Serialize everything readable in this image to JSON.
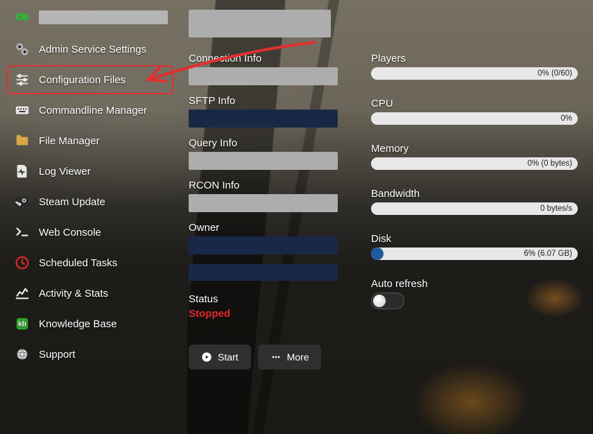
{
  "sidebar": {
    "items": [
      {
        "label": "Admin Service Settings",
        "icon": "gear-icon"
      },
      {
        "label": "Configuration Files",
        "icon": "sliders-icon",
        "highlighted": true
      },
      {
        "label": "Commandline Manager",
        "icon": "keyboard-icon"
      },
      {
        "label": "File Manager",
        "icon": "folder-icon"
      },
      {
        "label": "Log Viewer",
        "icon": "file-pulse-icon"
      },
      {
        "label": "Steam Update",
        "icon": "steam-icon"
      },
      {
        "label": "Web Console",
        "icon": "terminal-icon"
      },
      {
        "label": "Scheduled Tasks",
        "icon": "clock-icon"
      },
      {
        "label": "Activity & Stats",
        "icon": "chart-icon"
      },
      {
        "label": "Knowledge Base",
        "icon": "kb-icon"
      },
      {
        "label": "Support",
        "icon": "globe-icon"
      }
    ]
  },
  "info": {
    "connection_label": "Connection Info",
    "sftp_label": "SFTP Info",
    "query_label": "Query Info",
    "rcon_label": "RCON Info",
    "owner_label": "Owner",
    "status_label": "Status",
    "status_value": "Stopped"
  },
  "metrics": {
    "players": {
      "label": "Players",
      "text": "0% (0/60)",
      "percent": 0
    },
    "cpu": {
      "label": "CPU",
      "text": "0%",
      "percent": 0
    },
    "memory": {
      "label": "Memory",
      "text": "0% (0 bytes)",
      "percent": 0
    },
    "bandwidth": {
      "label": "Bandwidth",
      "text": "0 bytes/s",
      "percent": 0
    },
    "disk": {
      "label": "Disk",
      "text": "6% (6.07 GB)",
      "percent": 6
    },
    "auto_refresh_label": "Auto refresh",
    "auto_refresh_on": false
  },
  "buttons": {
    "start": "Start",
    "more": "More"
  },
  "colors": {
    "highlight_border": "#e03030",
    "status_stopped": "#e12828",
    "progress_fill": "#1e5a9e"
  }
}
